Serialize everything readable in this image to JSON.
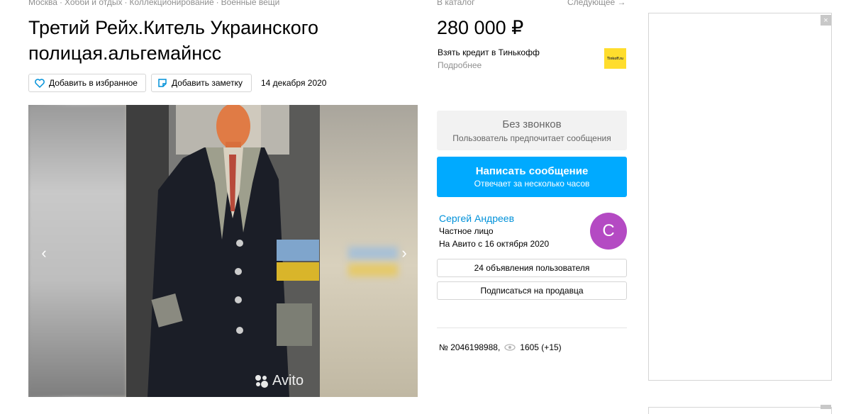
{
  "breadcrumbs": [
    "Москва",
    "Хобби и отдых",
    "Коллекционирование",
    "Военные вещи"
  ],
  "breadcrumb_separator": "·",
  "title": "Третий Рейх.Китель Украинского полицая.альгемайнсс",
  "actions": {
    "favorite_label": "Добавить в избранное",
    "note_label": "Добавить заметку",
    "date": "14 декабря 2020"
  },
  "gallery": {
    "watermark": "Avito",
    "prev_icon": "chevron-left-icon",
    "next_icon": "chevron-right-icon"
  },
  "top_links": {
    "catalog": "В каталог",
    "next": "Следующее →"
  },
  "price": "280 000 ₽",
  "credit": {
    "label": "Взять кредит в Тинькофф",
    "more": "Подробнее",
    "logo_text": "Tinkoff.ru",
    "logo_color": "#ffdd2d"
  },
  "no_calls": {
    "title": "Без звонков",
    "subtitle": "Пользователь предпочитает сообщения"
  },
  "message_button": {
    "title": "Написать сообщение",
    "subtitle": "Отвечает за несколько часов",
    "color": "#00aaff"
  },
  "seller": {
    "name": "Сергей Андреев",
    "type": "Частное лицо",
    "since": "На Авито с 16 октября 2020",
    "avatar_letter": "С",
    "avatar_color": "#b44ac3"
  },
  "seller_ads_button": "24 объявления пользователя",
  "subscribe_button": "Подписаться на продавца",
  "meta": {
    "number": "№ 2046198988,",
    "views": "1605 (+15)"
  },
  "ad": {
    "close_label": "×"
  }
}
